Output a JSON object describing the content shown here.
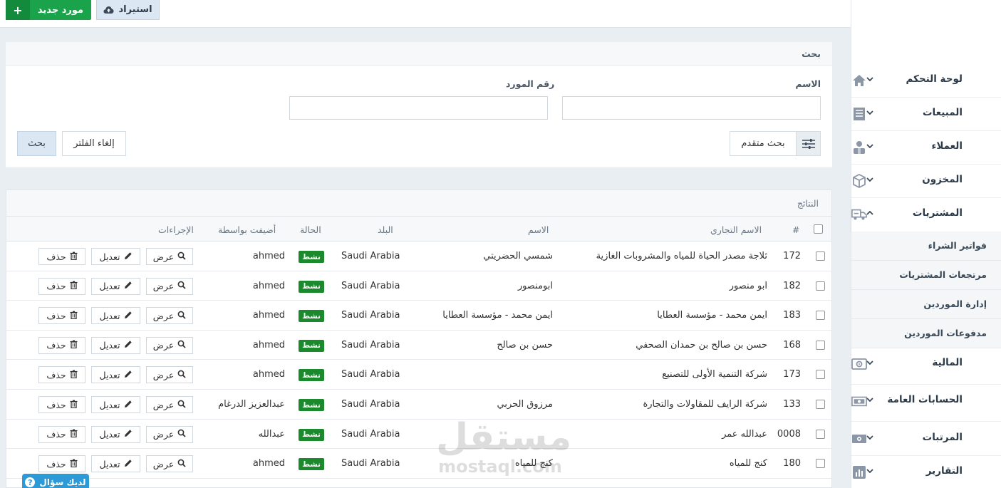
{
  "toolbar": {
    "new_supplier_label": "مورد جديد",
    "new_supplier_icon": "plus-icon",
    "import_label": "استيراد",
    "import_icon": "cloud-upload-icon"
  },
  "search": {
    "title": "بحث",
    "name_label": "الاسم",
    "name_value": "",
    "supplier_no_label": "رقم المورد",
    "supplier_no_value": "",
    "advanced_label": "بحث متقدم",
    "clear_label": "إلغاء الفلتر",
    "search_label": "بحث"
  },
  "results": {
    "title": "النتائج",
    "columns": {
      "num": "#",
      "trade_name": "الاسم التجاري",
      "name": "الاسم",
      "country": "البلد",
      "status": "الحالة",
      "added_by": "أضيفت بواسطة",
      "actions": "الإجراءات"
    },
    "action_labels": {
      "view": "عرض",
      "edit": "تعديل",
      "delete": "حذف"
    },
    "rows": [
      {
        "id": "172",
        "trade_name": "ثلاجة مصدر الحياة للمياه والمشروبات الغازية",
        "name": "شمسي الحضريتي",
        "country": "Saudi Arabia",
        "status": "نشط",
        "added_by": "ahmed"
      },
      {
        "id": "182",
        "trade_name": "ابو منصور",
        "name": "ابومنصور",
        "country": "Saudi Arabia",
        "status": "نشط",
        "added_by": "ahmed"
      },
      {
        "id": "183",
        "trade_name": "ايمن محمد - مؤسسة العطايا",
        "name": "ايمن محمد - مؤسسة العطايا",
        "country": "Saudi Arabia",
        "status": "نشط",
        "added_by": "ahmed"
      },
      {
        "id": "168",
        "trade_name": "حسن بن صالح بن حمدان الصحفي",
        "name": "حسن بن صالح",
        "country": "Saudi Arabia",
        "status": "نشط",
        "added_by": "ahmed"
      },
      {
        "id": "173",
        "trade_name": "شركة التنمية الأولى للتصنيع",
        "name": "",
        "country": "Saudi Arabia",
        "status": "نشط",
        "added_by": "ahmed"
      },
      {
        "id": "133",
        "trade_name": "شركة الرايف للمقاولات والتجارة",
        "name": "مرزوق الحربي",
        "country": "Saudi Arabia",
        "status": "نشط",
        "added_by": "عبدالعزيز الدرغام"
      },
      {
        "id": "0008",
        "trade_name": "عبدالله عمر",
        "name": "",
        "country": "Saudi Arabia",
        "status": "نشط",
        "added_by": "عبدالله"
      },
      {
        "id": "180",
        "trade_name": "كنج للمياه",
        "name": "كنج للمياه",
        "country": "Saudi Arabia",
        "status": "نشط",
        "added_by": "ahmed"
      }
    ]
  },
  "sidebar": {
    "items": [
      {
        "label": "لوحة التحكم",
        "icon": "home-icon"
      },
      {
        "label": "المبيعات",
        "icon": "receipt-icon"
      },
      {
        "label": "العملاء",
        "icon": "users-icon"
      },
      {
        "label": "المخزون",
        "icon": "box-icon"
      },
      {
        "label": "المشتريات",
        "icon": "truck-icon"
      },
      {
        "label": "المالية",
        "icon": "safe-icon"
      },
      {
        "label": "الحسابات العامة",
        "icon": "money-icon"
      },
      {
        "label": "المرتبات",
        "icon": "cash-icon"
      },
      {
        "label": "التقارير",
        "icon": "chart-icon"
      }
    ],
    "purchases_sub": [
      "فواتير الشراء",
      "مرتجعات المشتريات",
      "إدارة الموردين",
      "مدفوعات الموردين"
    ]
  },
  "watermark": {
    "arabic": "مستقل",
    "latin": "mostaql.com"
  },
  "help": {
    "label": "لديك سؤال",
    "icon": "question-icon"
  },
  "colors": {
    "primary_green": "#1aa34a",
    "badge_green": "#1a8a2c",
    "light_blue": "#dbe7f3",
    "help_blue": "#2c9ad6"
  }
}
